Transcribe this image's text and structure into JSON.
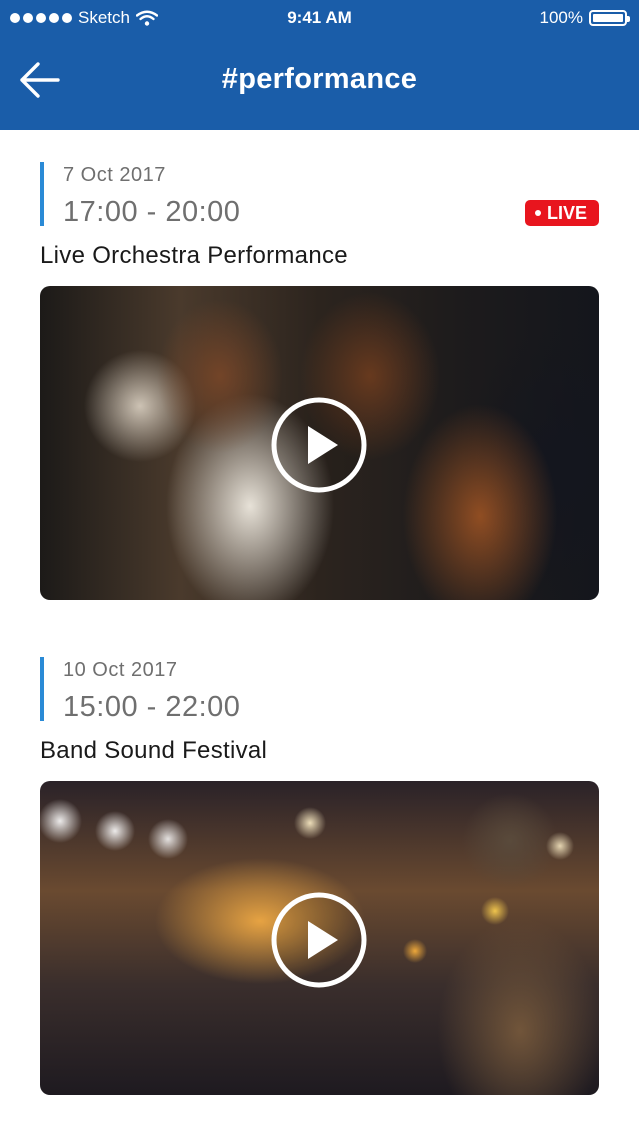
{
  "status_bar": {
    "carrier": "Sketch",
    "time": "9:41 AM",
    "battery": "100%"
  },
  "header": {
    "title": "#performance"
  },
  "events": [
    {
      "date": "7 Oct 2017",
      "time": "17:00 - 20:00",
      "title": "Live Orchestra Performance",
      "badge": "LIVE"
    },
    {
      "date": "10 Oct 2017",
      "time": "15:00 - 22:00",
      "title": "Band Sound Festival"
    }
  ],
  "colors": {
    "header_bg": "#1a5da9",
    "accent_bar": "#2a8ad6",
    "live_badge": "#e8151e"
  },
  "icons": {
    "back": "back-arrow-icon",
    "play": "play-icon",
    "wifi": "wifi-icon",
    "battery": "battery-icon",
    "signal": "signal-dots-icon"
  }
}
